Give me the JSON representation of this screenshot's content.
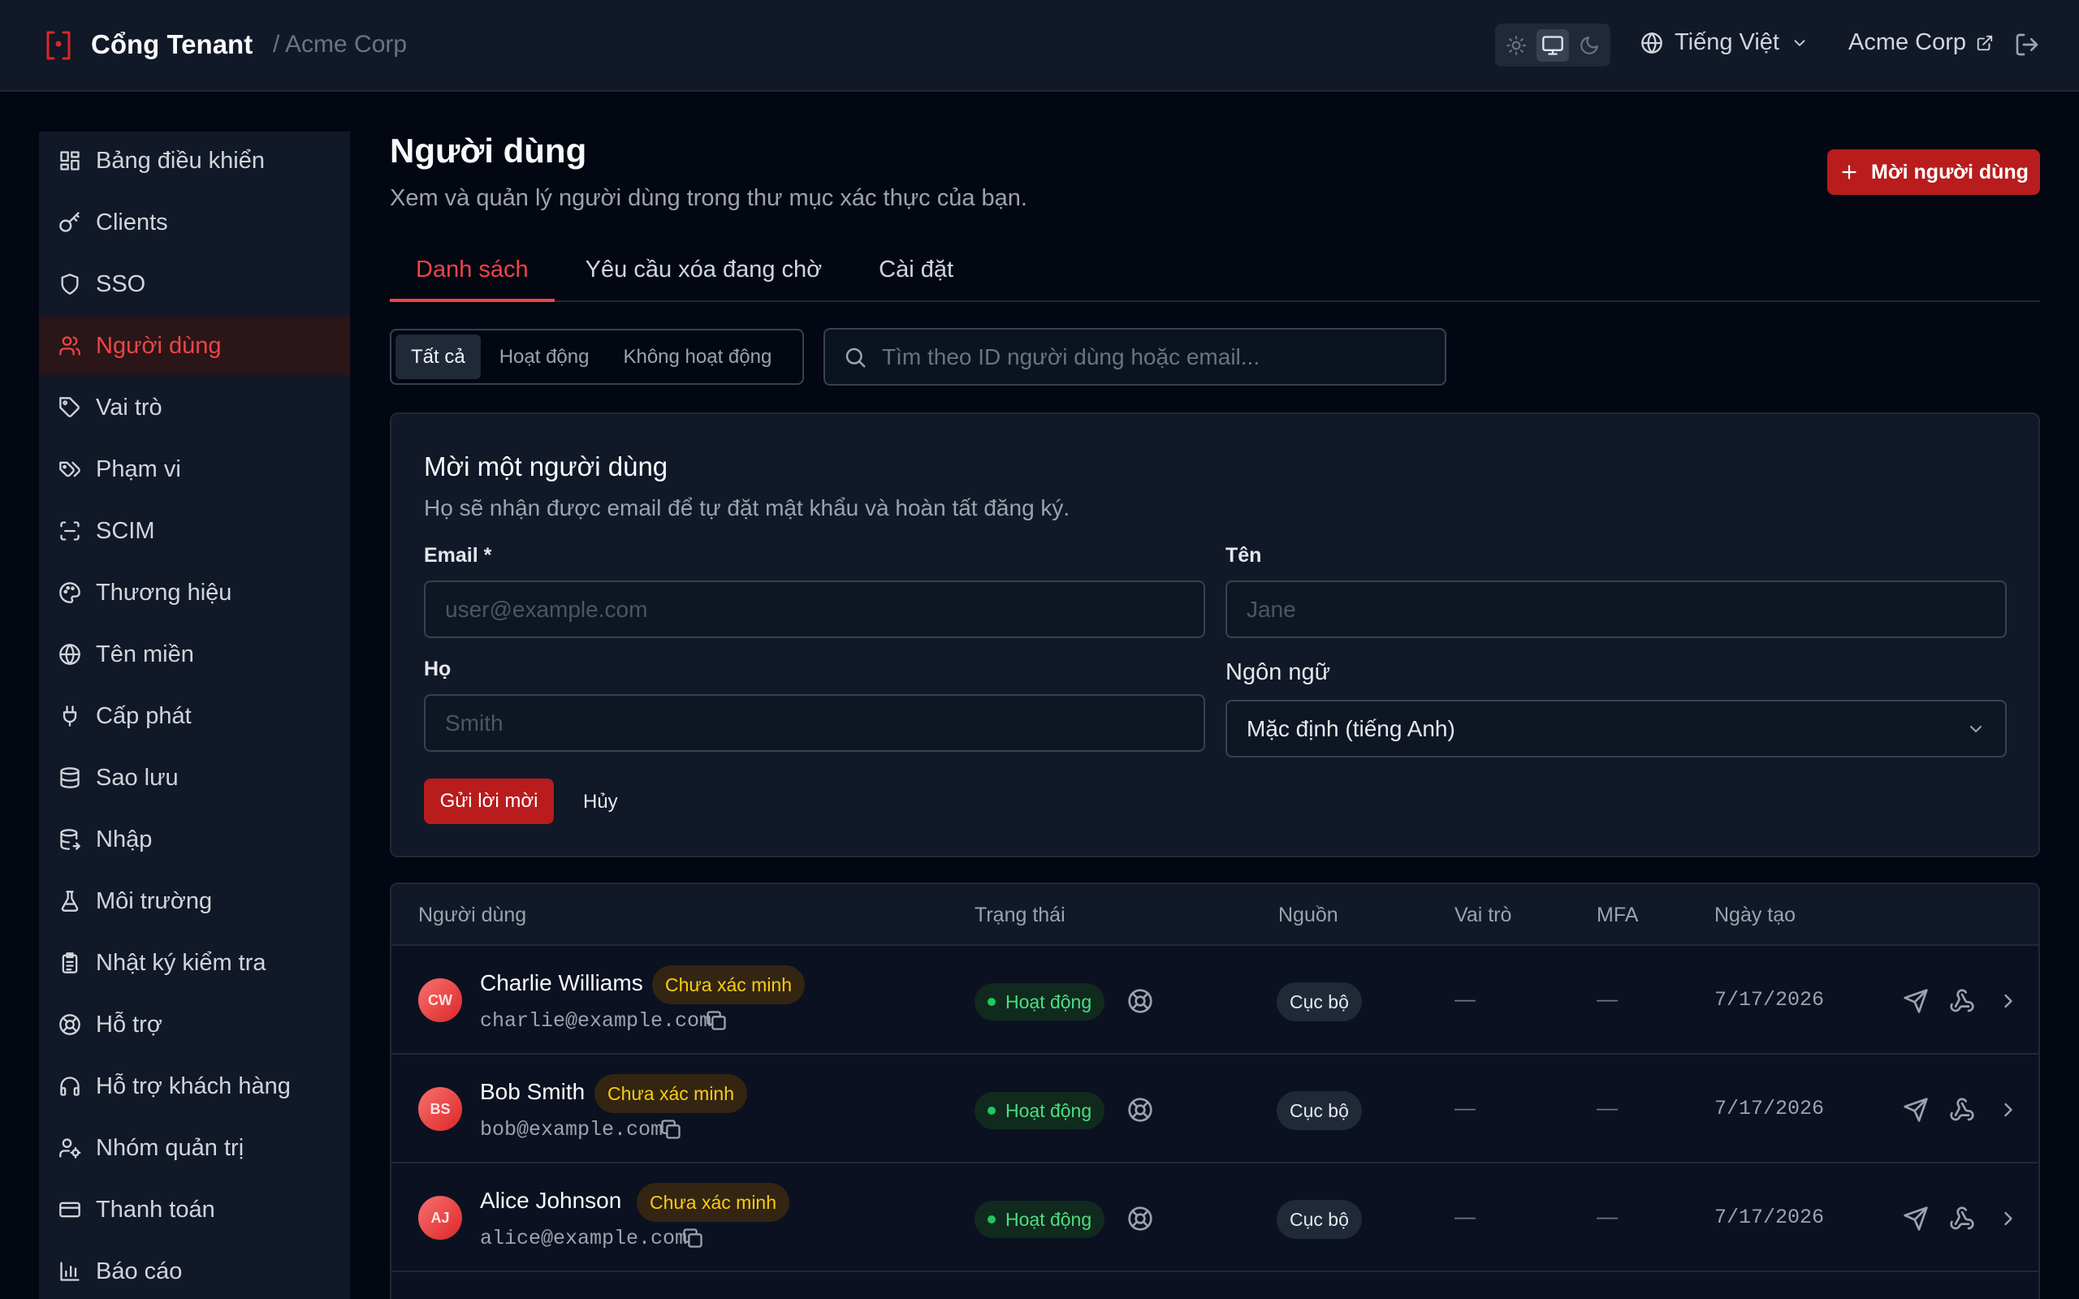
{
  "header": {
    "brand": "Cổng Tenant",
    "breadcrumb": "/ Acme Corp",
    "language": "Tiếng Việt",
    "tenant": "Acme Corp",
    "theme_active": "system"
  },
  "sidebar": {
    "items": [
      {
        "label": "Bảng điều khiển",
        "icon": "dashboard-icon"
      },
      {
        "label": "Clients",
        "icon": "key-icon"
      },
      {
        "label": "SSO",
        "icon": "shield-icon"
      },
      {
        "label": "Người dùng",
        "icon": "users-icon",
        "active": true
      },
      {
        "label": "Vai trò",
        "icon": "tag-icon"
      },
      {
        "label": "Phạm vi",
        "icon": "tags-icon"
      },
      {
        "label": "SCIM",
        "icon": "scan-icon"
      },
      {
        "label": "Thương hiệu",
        "icon": "palette-icon"
      },
      {
        "label": "Tên miền",
        "icon": "globe-icon"
      },
      {
        "label": "Cấp phát",
        "icon": "plug-icon"
      },
      {
        "label": "Sao lưu",
        "icon": "database-icon"
      },
      {
        "label": "Nhập",
        "icon": "database-import-icon"
      },
      {
        "label": "Môi trường",
        "icon": "flask-icon"
      },
      {
        "label": "Nhật ký kiểm tra",
        "icon": "clipboard-icon"
      },
      {
        "label": "Hỗ trợ",
        "icon": "lifebuoy-icon"
      },
      {
        "label": "Hỗ trợ khách hàng",
        "icon": "headphones-icon"
      },
      {
        "label": "Nhóm quản trị",
        "icon": "user-cog-icon"
      },
      {
        "label": "Thanh toán",
        "icon": "credit-card-icon"
      },
      {
        "label": "Báo cáo",
        "icon": "bar-chart-icon"
      }
    ]
  },
  "page": {
    "title": "Người dùng",
    "subtitle": "Xem và quản lý người dùng trong thư mục xác thực của bạn.",
    "invite_button": "Mời người dùng"
  },
  "tabs": [
    {
      "label": "Danh sách",
      "active": true
    },
    {
      "label": "Yêu cầu xóa đang chờ"
    },
    {
      "label": "Cài đặt"
    }
  ],
  "filters": {
    "options": [
      "Tất cả",
      "Hoạt động",
      "Không hoạt động"
    ],
    "selected": "Tất cả",
    "search_placeholder": "Tìm theo ID người dùng hoặc email..."
  },
  "invite_form": {
    "title": "Mời một người dùng",
    "subtitle": "Họ sẽ nhận được email để tự đặt mật khẩu và hoàn tất đăng ký.",
    "email_label": "Email *",
    "email_placeholder": "user@example.com",
    "first_name_label": "Tên",
    "first_name_placeholder": "Jane",
    "last_name_label": "Họ",
    "last_name_placeholder": "Smith",
    "language_label": "Ngôn ngữ",
    "language_value": "Mặc định (tiếng Anh)",
    "submit_label": "Gửi lời mời",
    "cancel_label": "Hủy"
  },
  "table": {
    "columns": [
      "Người dùng",
      "Trạng thái",
      "Nguồn",
      "Vai trò",
      "MFA",
      "Ngày tạo"
    ],
    "rows": [
      {
        "initials": "CW",
        "name": "Charlie Williams",
        "badge": "Chưa xác minh",
        "email": "charlie@example.com",
        "status": "Hoạt động",
        "source": "Cục bộ",
        "roles": "—",
        "mfa": "—",
        "created": "7/17/2026"
      },
      {
        "initials": "BS",
        "name": "Bob Smith",
        "badge": "Chưa xác minh",
        "email": "bob@example.com",
        "status": "Hoạt động",
        "source": "Cục bộ",
        "roles": "—",
        "mfa": "—",
        "created": "7/17/2026"
      },
      {
        "initials": "AJ",
        "name": "Alice Johnson",
        "badge": "Chưa xác minh",
        "email": "alice@example.com",
        "status": "Hoạt động",
        "source": "Cục bộ",
        "roles": "—",
        "mfa": "—",
        "created": "7/17/2026"
      }
    ]
  },
  "colors": {
    "accent": "#dc2626",
    "background": "#030712",
    "surface": "#111827",
    "status_active": "#4ade80",
    "badge_unverified": "#facc15"
  }
}
